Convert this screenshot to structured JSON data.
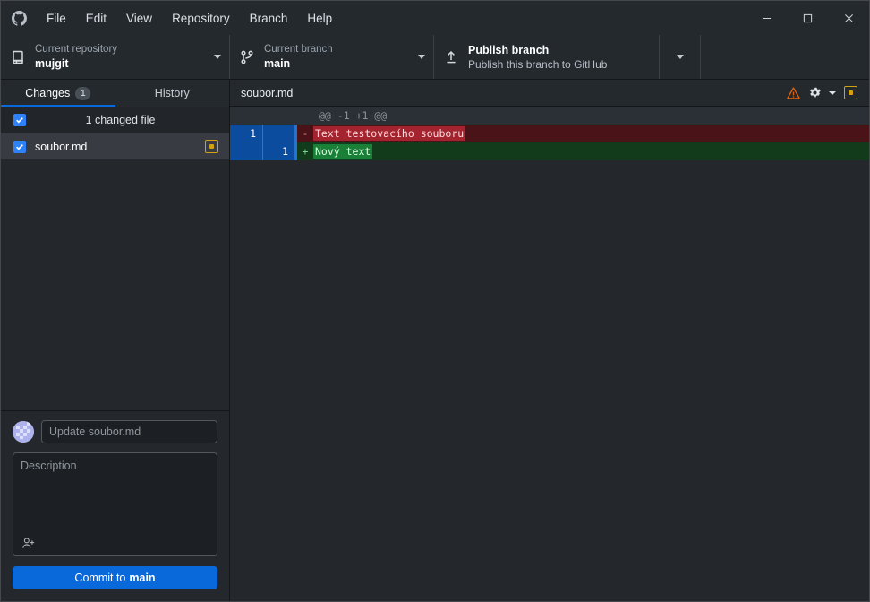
{
  "window": {
    "app_icon": "github-mark-icon",
    "menu": [
      "File",
      "Edit",
      "View",
      "Repository",
      "Branch",
      "Help"
    ],
    "controls": {
      "minimize": "minimize-icon",
      "maximize": "maximize-icon",
      "close": "close-icon"
    }
  },
  "toolbar": {
    "repository": {
      "icon": "repo-icon",
      "label": "Current repository",
      "value": "mujgit",
      "caret": "chevron-down-icon"
    },
    "branch": {
      "icon": "git-branch-icon",
      "label": "Current branch",
      "value": "main",
      "caret": "chevron-down-icon"
    },
    "publish": {
      "icon": "upload-icon",
      "title": "Publish branch",
      "subtitle": "Publish this branch to GitHub",
      "caret": "chevron-down-icon"
    }
  },
  "sidebar": {
    "tabs": [
      {
        "label": "Changes",
        "badge": "1",
        "active": true
      },
      {
        "label": "History",
        "badge": "",
        "active": false
      }
    ],
    "changed_header": {
      "text": "1 changed file",
      "checked": true
    },
    "files": [
      {
        "name": "soubor.md",
        "checked": true,
        "status": "modified",
        "status_icon": "modified-status-icon",
        "selected": true
      }
    ],
    "commit": {
      "avatar": "user-avatar",
      "summary_placeholder": "Update soubor.md",
      "summary_value": "",
      "description_placeholder": "Description",
      "description_value": "",
      "coauthor_icon": "add-coauthor-icon",
      "button_prefix": "Commit to ",
      "button_branch": "main"
    }
  },
  "diff": {
    "filename": "soubor.md",
    "actions": {
      "warning": "warning-triangle-icon",
      "settings": "gear-icon",
      "settings_caret": "chevron-down-icon",
      "status": "modified-status-icon"
    },
    "hunk_header": "@@ -1 +1 @@",
    "lines": [
      {
        "type": "hunk",
        "old_no": "",
        "new_no": "",
        "sign": "",
        "text": "@@ -1 +1 @@"
      },
      {
        "type": "deletion",
        "old_no": "1",
        "new_no": "",
        "sign": "-",
        "text": "Text testovacího souboru"
      },
      {
        "type": "addition",
        "old_no": "",
        "new_no": "1",
        "sign": "+",
        "text": "Nový text"
      }
    ]
  },
  "colors": {
    "accent_blue": "#0a69da",
    "selection_blue": "#0b4c9e",
    "addition_green": "#1a7f37",
    "deletion_red": "#a3242f",
    "modified_yellow": "#d1a212",
    "warning_orange": "#e36209",
    "background": "#24292e",
    "panel": "#24282c"
  }
}
